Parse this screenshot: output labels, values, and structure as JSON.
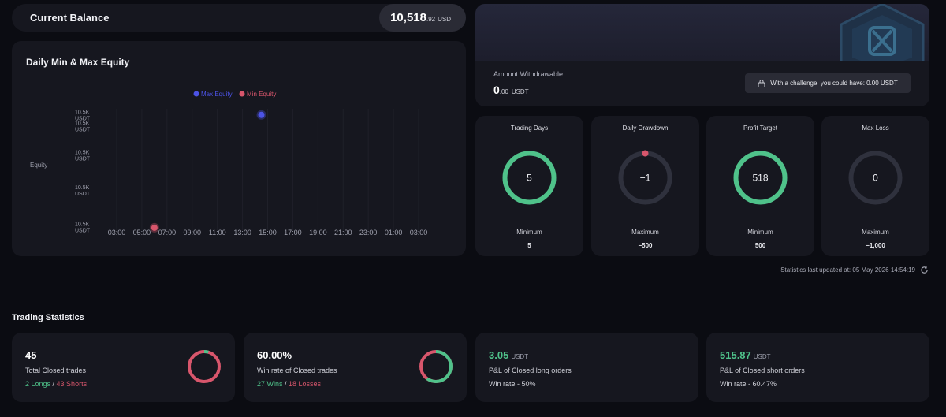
{
  "balance": {
    "label": "Current Balance",
    "amount": "10,518",
    "decimals": ".92",
    "unit": "USDT"
  },
  "equity_chart": {
    "title": "Daily Min & Max Equity",
    "ylabel": "Equity",
    "legend": [
      {
        "name": "Max Equity",
        "color": "#4c53e6"
      },
      {
        "name": "Min Equity",
        "color": "#d8566c"
      }
    ],
    "yticks": [
      "10.5K\nUSDT",
      "10.5K\nUSDT",
      "10.5K\nUSDT",
      "10.5K\nUSDT",
      "10.5K\nUSDT"
    ],
    "xticks": [
      "03:00",
      "05:00",
      "07:00",
      "09:00",
      "11:00",
      "13:00",
      "15:00",
      "17:00",
      "19:00",
      "21:00",
      "23:00",
      "01:00",
      "03:00"
    ]
  },
  "chart_data": {
    "type": "scatter",
    "title": "Daily Min & Max Equity",
    "xlabel": "",
    "ylabel": "Equity",
    "x_categories": [
      "03:00",
      "05:00",
      "07:00",
      "09:00",
      "11:00",
      "13:00",
      "15:00",
      "17:00",
      "19:00",
      "21:00",
      "23:00",
      "01:00",
      "03:00"
    ],
    "series": [
      {
        "name": "Max Equity",
        "color": "#4c53e6",
        "x": "14:30",
        "y_rel": 0.95
      },
      {
        "name": "Min Equity",
        "color": "#d8566c",
        "x": "06:00",
        "y_rel": 0.02
      }
    ],
    "grid": true,
    "legend_position": "top"
  },
  "withdraw": {
    "label": "Amount Withdrawable",
    "amount": "0",
    "decimals": ".00",
    "unit": "USDT",
    "challenge": "With a challenge, you could have: 0.00 USDT"
  },
  "stats": [
    {
      "title": "Trading Days",
      "value": "5",
      "rlabel": "Minimum",
      "rval": "5",
      "progress": 1.0,
      "color": "#4fc28a",
      "dot": false
    },
    {
      "title": "Daily Drawdown",
      "value": "−1",
      "rlabel": "Maximum",
      "rval": "−500",
      "progress": 0.0,
      "color": "#d8566c",
      "dot": true
    },
    {
      "title": "Profit Target",
      "value": "518",
      "rlabel": "Minimum",
      "rval": "500",
      "progress": 1.0,
      "color": "#4fc28a",
      "dot": false
    },
    {
      "title": "Max Loss",
      "value": "0",
      "rlabel": "Maximum",
      "rval": "−1,000",
      "progress": 0.0,
      "color": "#4fc28a",
      "dot": false
    }
  ],
  "updated": "Statistics last updated at: 05 May 2026 14:54:19",
  "trading_stats_title": "Trading Statistics",
  "bottom": [
    {
      "value": "45",
      "unit": "",
      "desc": "Total Closed trades",
      "a": "2 Longs",
      "b": "43 Shorts",
      "green_value": false
    },
    {
      "value": "60.00%",
      "unit": "",
      "desc": "Win rate of Closed trades",
      "a": "27 Wins",
      "b": "18 Losses",
      "green_value": false
    },
    {
      "value": "3.05",
      "unit": "USDT",
      "desc": "P&L of Closed long orders",
      "sub": "Win rate - 50%",
      "green_value": true
    },
    {
      "value": "515.87",
      "unit": "USDT",
      "desc": "P&L of Closed short orders",
      "sub": "Win rate - 60.47%",
      "green_value": true
    }
  ],
  "colors": {
    "green": "#4fc28a",
    "red": "#d8566c",
    "blue": "#4c53e6",
    "track": "#2f313d"
  }
}
